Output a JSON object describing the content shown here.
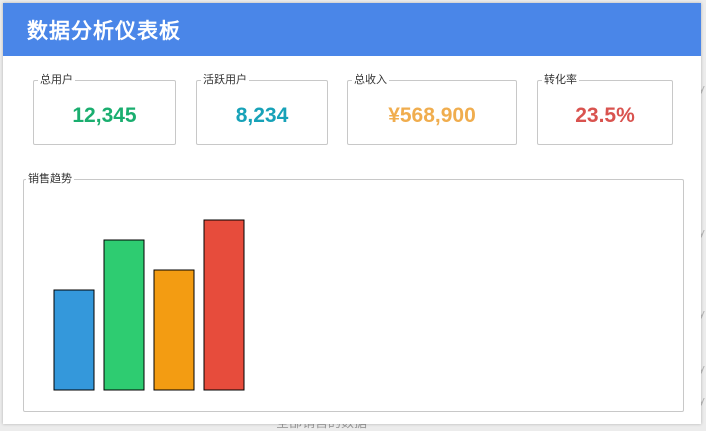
{
  "window": {
    "title": "数据分析仪表板"
  },
  "stats": [
    {
      "label": "总用户",
      "value": "12,345",
      "color": "#1aae6f"
    },
    {
      "label": "活跃用户",
      "value": "8,234",
      "color": "#17a2b8"
    },
    {
      "label": "总收入",
      "value": "¥568,900",
      "color": "#f0ad4e"
    },
    {
      "label": "转化率",
      "value": "23.5%",
      "color": "#d9534f"
    }
  ],
  "sales_panel": {
    "label": "销售趋势"
  },
  "chart_data": {
    "type": "bar",
    "values": [
      10,
      15,
      12,
      17
    ],
    "colors": [
      "#3498db",
      "#2ecc71",
      "#f39c12",
      "#e74c3c"
    ],
    "ylim": [
      0,
      20
    ],
    "grid": false
  },
  "background": {
    "partial_text": "全部销售的数据"
  }
}
